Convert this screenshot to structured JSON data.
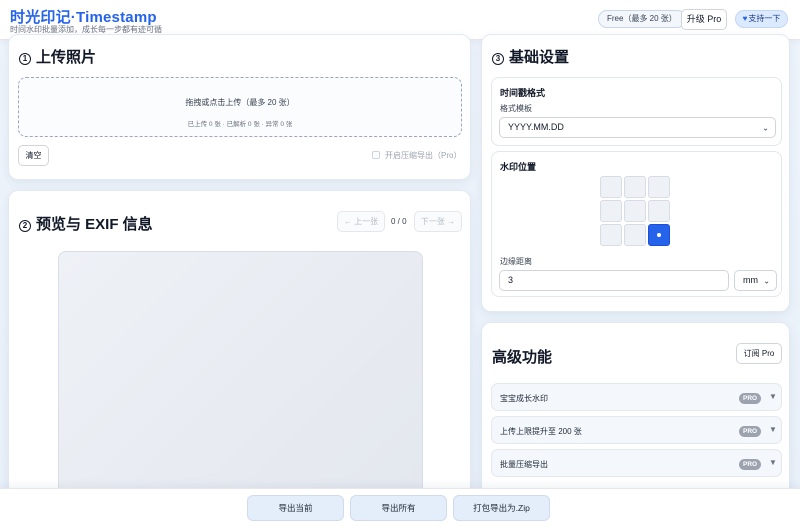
{
  "header": {
    "title": "时光印记·Timestamp",
    "subtitle": "时间水印批量添加，成长每一步都有迹可循",
    "plan_badge": "Free（最多 20 张）",
    "upgrade_label": "升级 Pro",
    "support_icon": "heart-icon",
    "support_label": "支持一下"
  },
  "upload": {
    "num": "1",
    "title": "上传照片",
    "dropzone_text": "拖拽或点击上传（最多 20 张）",
    "stats_text": "已上传 0 张 · 已解析 0 张 · 异常 0 张",
    "clear_label": "清空",
    "zip_toggle_label": "开启压缩导出（Pro）"
  },
  "preview": {
    "num": "2",
    "title": "预览与 EXIF 信息",
    "prev_label": "← 上一张",
    "next_label": "下一张 →",
    "page_count": "0 / 0"
  },
  "settings": {
    "num": "3",
    "title": "基础设置",
    "format_section_title": "时间戳格式",
    "template_label": "格式模板",
    "template_value": "YYYY.MM.DD",
    "position_section_title": "水印位置",
    "position_selected": "bottom-right",
    "margin_label": "边缘距离",
    "margin_value": "3",
    "unit_value": "mm"
  },
  "advanced": {
    "title": "高级功能",
    "subscribe_label": "订阅 Pro",
    "features": [
      {
        "label": "宝宝成长水印",
        "badge": "PRO"
      },
      {
        "label": "上传上限提升至 200 张",
        "badge": "PRO"
      },
      {
        "label": "批量压缩导出",
        "badge": "PRO"
      }
    ]
  },
  "footer": {
    "export_current": "导出当前",
    "export_all": "导出所有",
    "export_zip": "打包导出为.Zip"
  },
  "colors": {
    "accent": "#2563eb",
    "badge_gray": "#9ca3af",
    "export_button_bg": "#e4eefb"
  }
}
